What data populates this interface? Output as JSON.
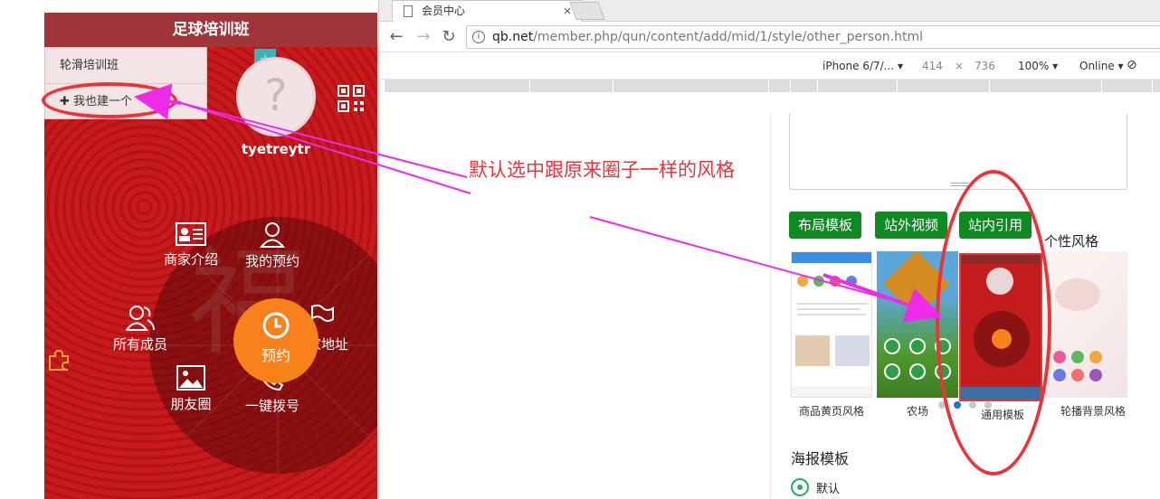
{
  "phone": {
    "title": "足球培训班",
    "dropdown": {
      "item_1": "轮滑培训班",
      "item_2": "✚ 我也建一个"
    },
    "username": "tyetreytr",
    "menu": {
      "business_intro": "商家介绍",
      "my_booking": "我的预约",
      "all_members": "所有成员",
      "business_address": "商家地址",
      "moments": "朋友圈",
      "one_click_dial": "一键拨号",
      "center": "预约"
    }
  },
  "browser": {
    "tab_title": "会员中心",
    "tab_close": "×",
    "url_host": "qb.net",
    "url_path": "/member.php/qun/content/add/mid/1/style/other_person.html",
    "device": "iPhone 6/7/...",
    "width": "414",
    "times": "×",
    "height": "736",
    "zoom": "100%",
    "network": "Online"
  },
  "editor": {
    "buttons": {
      "layout_template": "布局模板",
      "external_video": "站外视频",
      "internal_quote": "站内引用"
    },
    "personal_style_label": "个性风格",
    "templates": [
      {
        "caption": "商品黄页风格"
      },
      {
        "caption": "农场"
      },
      {
        "caption": "通用模板"
      },
      {
        "caption": "轮播背景风格"
      }
    ],
    "poster_title": "海报模板",
    "poster_default": "默认"
  },
  "annotation": {
    "text": "默认选中跟原来圈子一样的风格",
    "color": "#ec3338",
    "arrow_color": "#ee2be9"
  },
  "colors": {
    "green_button": "#0f8a23",
    "orange_center": "#f7821c",
    "header": "#a0363a"
  }
}
